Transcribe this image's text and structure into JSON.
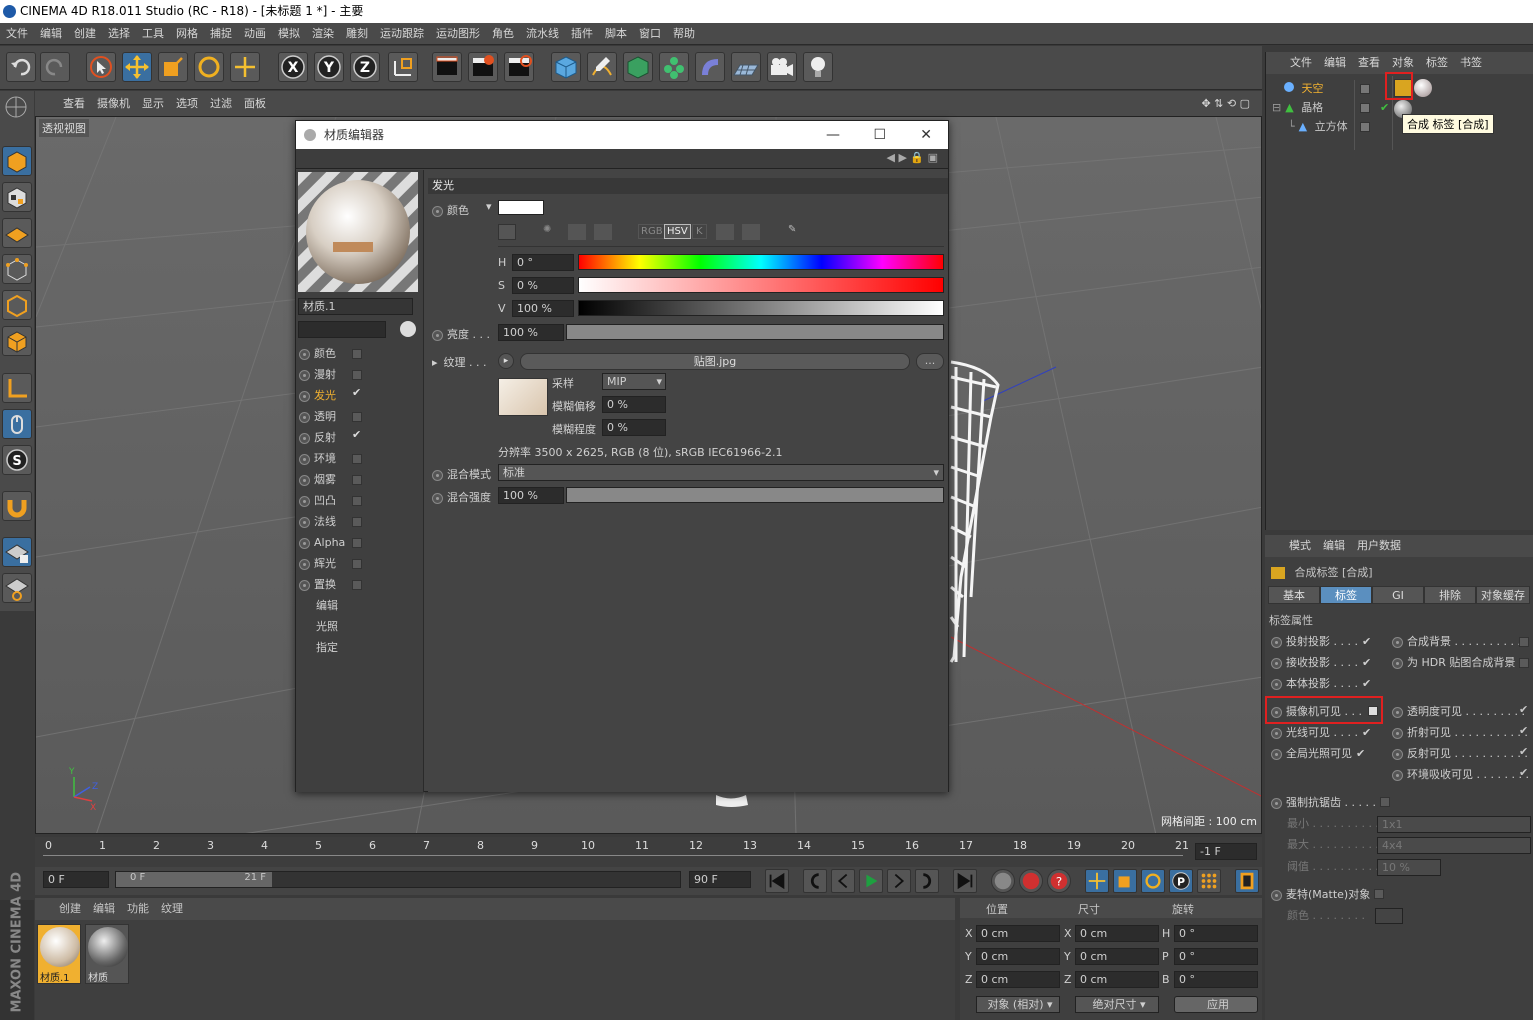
{
  "window": {
    "title": "CINEMA 4D R18.011 Studio (RC - R18) - [未标题 1 *] - 主要"
  },
  "menubar": [
    "文件",
    "编辑",
    "创建",
    "选择",
    "工具",
    "网格",
    "捕捉",
    "动画",
    "模拟",
    "渲染",
    "雕刻",
    "运动跟踪",
    "运动图形",
    "角色",
    "流水线",
    "插件",
    "脚本",
    "窗口",
    "帮助"
  ],
  "viewport": {
    "menu": [
      "查看",
      "摄像机",
      "显示",
      "选项",
      "过滤",
      "面板"
    ],
    "label": "透视视图",
    "grid_info": "网格间距 : 100 cm",
    "axis": {
      "y": "Y",
      "z": "Z",
      "x": "X"
    }
  },
  "material_editor": {
    "title": "材质编辑器",
    "material_name": "材质.1",
    "channels": [
      {
        "label": "颜色",
        "checked": false
      },
      {
        "label": "漫射",
        "checked": false
      },
      {
        "label": "发光",
        "checked": true,
        "active": true
      },
      {
        "label": "透明",
        "checked": false
      },
      {
        "label": "反射",
        "checked": true
      },
      {
        "label": "环境",
        "checked": false
      },
      {
        "label": "烟雾",
        "checked": false
      },
      {
        "label": "凹凸",
        "checked": false
      },
      {
        "label": "法线",
        "checked": false
      },
      {
        "label": "Alpha",
        "checked": false
      },
      {
        "label": "辉光",
        "checked": false
      },
      {
        "label": "置换",
        "checked": false
      }
    ],
    "extra": [
      "编辑",
      "光照",
      "指定"
    ],
    "section": "发光",
    "color_label": "颜色",
    "h_label": "H",
    "h_value": "0 °",
    "s_label": "S",
    "s_value": "0 %",
    "v_label": "V",
    "v_value": "100 %",
    "color_modes": [
      "RGB",
      "HSV",
      "K"
    ],
    "brightness_label": "亮度 . . .",
    "brightness_value": "100 %",
    "texture_label": "纹理 . . .",
    "texture_file": "贴图.jpg",
    "texture_more": "...",
    "sampling_label": "采样",
    "sampling_value": "MIP",
    "blur_offset_label": "模糊偏移",
    "blur_offset_value": "0 %",
    "blur_scale_label": "模糊程度",
    "blur_scale_value": "0 %",
    "resolution": "分辨率 3500 x 2625, RGB (8 位), sRGB IEC61966-2.1",
    "mix_mode_label": "混合模式",
    "mix_mode_value": "标准",
    "mix_strength_label": "混合强度",
    "mix_strength_value": "100 %"
  },
  "object_manager": {
    "menu": [
      "文件",
      "编辑",
      "查看",
      "对象",
      "标签",
      "书签"
    ],
    "objects": [
      {
        "name": "天空",
        "color": "#f0b030"
      },
      {
        "name": "晶格",
        "color": "#d0d0d0"
      },
      {
        "name": "立方体",
        "color": "#d0d0d0"
      }
    ],
    "tooltip": "合成 标签 [合成]"
  },
  "attribute_manager": {
    "menu": [
      "模式",
      "编辑",
      "用户数据"
    ],
    "title": "合成标签 [合成]",
    "tabs": [
      "基本",
      "标签",
      "GI",
      "排除",
      "对象缓存"
    ],
    "active_tab": "标签",
    "section": "标签属性",
    "left_props": [
      {
        "label": "投射投影 . . . .",
        "checked": true
      },
      {
        "label": "接收投影 . . . .",
        "checked": true
      },
      {
        "label": "本体投影 . . . .",
        "checked": true
      },
      {
        "label": "摄像机可见 . . .",
        "checked": false
      },
      {
        "label": "光线可见 . . . .",
        "checked": true
      },
      {
        "label": "全局光照可见",
        "checked": true
      }
    ],
    "right_props": [
      {
        "label": "合成背景 . . . . . . . . . . .",
        "checked": false
      },
      {
        "label": "为 HDR 贴图合成背景",
        "checked": false
      },
      {
        "label": "透明度可见 . . . . . . . . .",
        "checked": true
      },
      {
        "label": "折射可见 . . . . . . . . . . .",
        "checked": true
      },
      {
        "label": "反射可见 . . . . . . . . . . .",
        "checked": true
      },
      {
        "label": "环境吸收可见 . . . . . . . .",
        "checked": true
      }
    ],
    "antialias_label": "强制抗锯齿 . . . . .",
    "min_label": "最小 . . . . . . . . . . .",
    "min_value": "1x1",
    "max_label": "最大 . . . . . . . . . . .",
    "max_value": "4x4",
    "threshold_label": "阈值 . . . . . . . . . . .",
    "threshold_value": "10 %",
    "matte_label": "麦特(Matte)对象",
    "color_label": "颜色 . . . . . . . ."
  },
  "timeline": {
    "ticks": [
      "0",
      "1",
      "2",
      "3",
      "4",
      "5",
      "6",
      "7",
      "8",
      "9",
      "10",
      "11",
      "12",
      "13",
      "14",
      "15",
      "16",
      "17",
      "18",
      "19",
      "20",
      "21"
    ],
    "current": "-1 F",
    "start": "0 F",
    "range_start": "0 F",
    "range_end": "21 F",
    "end": "90 F"
  },
  "material_manager": {
    "menu": [
      "创建",
      "编辑",
      "功能",
      "纹理"
    ],
    "materials": [
      {
        "name": "材质.1"
      },
      {
        "name": "材质"
      }
    ]
  },
  "coords": {
    "headers": [
      "位置",
      "尺寸",
      "旋转"
    ],
    "rows": [
      {
        "axis": "X",
        "pos": "0 cm",
        "size_axis": "X",
        "size": "0 cm",
        "rot_axis": "H",
        "rot": "0 °"
      },
      {
        "axis": "Y",
        "pos": "0 cm",
        "size_axis": "Y",
        "size": "0 cm",
        "rot_axis": "P",
        "rot": "0 °"
      },
      {
        "axis": "Z",
        "pos": "0 cm",
        "size_axis": "Z",
        "size": "0 cm",
        "rot_axis": "B",
        "rot": "0 °"
      }
    ],
    "mode": "对象 (相对)",
    "size_mode": "绝对尺寸",
    "apply": "应用"
  },
  "brand": "MAXON CINEMA 4D",
  "colors": {
    "accent": "#5b8fbf",
    "highlight": "#e02020",
    "active_channel": "#f0b030"
  }
}
